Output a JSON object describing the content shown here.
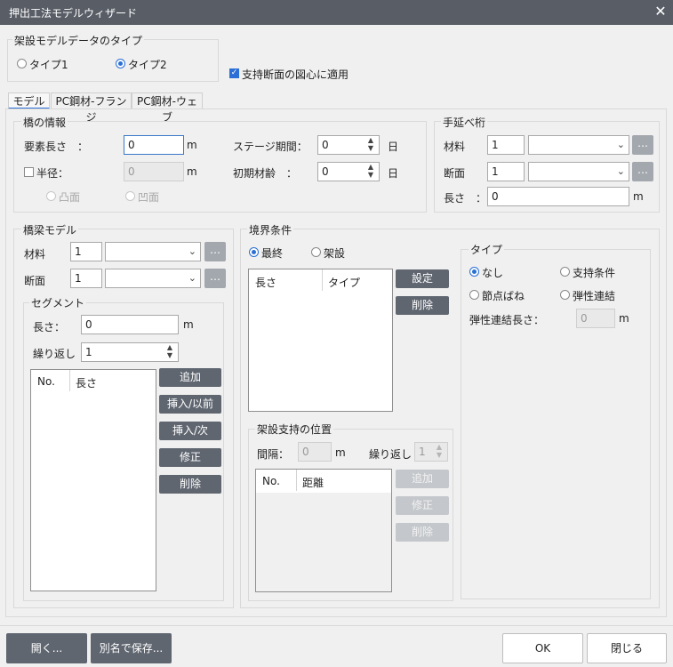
{
  "window": {
    "title": "押出工法モデルウィザード"
  },
  "arch_type": {
    "legend": "架設モデルデータのタイプ",
    "option1": "タイプ1",
    "option2": "タイプ2",
    "selected": "タイプ2"
  },
  "apply_centroid": {
    "label": "支持断面の図心に適用",
    "checked": true
  },
  "tabs": [
    "モデル",
    "PC鋼材-フランジ",
    "PC鋼材-ウェブ"
  ],
  "bridge_info": {
    "legend": "橋の情報",
    "element_length_label": "要素長さ　：",
    "element_length_value": "0",
    "unit_m": "m",
    "radius_label": "半径：",
    "radius_value": "0",
    "convex_label": "凸面",
    "concave_label": "凹面",
    "stage_label": "ステージ期間：",
    "stage_value": "0",
    "initial_age_label": "初期材齢　：",
    "initial_age_value": "0",
    "unit_day": "日"
  },
  "nose": {
    "legend": "手延べ桁",
    "material_label": "材料",
    "material_value": "1",
    "section_label": "断面",
    "section_value": "1",
    "length_label": "長さ　：",
    "length_value": "0",
    "unit_m": "m"
  },
  "girder": {
    "legend": "橋梁モデル",
    "material_label": "材料",
    "material_value": "1",
    "section_label": "断面",
    "section_value": "1"
  },
  "segment": {
    "legend": "セグメント",
    "length_label": "長さ：",
    "length_value": "0",
    "unit_m": "m",
    "repeat_label": "繰り返し",
    "repeat_value": "1",
    "col_no": "No.",
    "col_length": "長さ",
    "add": "追加",
    "insert_before": "挿入/以前",
    "insert_after": "挿入/次",
    "modify": "修正",
    "delete": "削除"
  },
  "boundary": {
    "legend": "境界条件",
    "final": "最終",
    "erection": "架設",
    "col_length": "長さ",
    "col_type": "タイプ",
    "set": "設定",
    "delete": "削除"
  },
  "type_group": {
    "legend": "タイプ",
    "none": "なし",
    "support": "支持条件",
    "node_spring": "節点ばね",
    "elastic_link": "弾性連結",
    "elastic_length_label": "弾性連結長さ：",
    "elastic_length_value": "0",
    "unit_m": "m"
  },
  "support_pos": {
    "legend": "架設支持の位置",
    "interval_label": "間隔：",
    "interval_value": "0",
    "unit_m": "m",
    "repeat_label": "繰り返し",
    "repeat_value": "1",
    "col_no": "No.",
    "col_distance": "距離",
    "add": "追加",
    "modify": "修正",
    "delete": "削除"
  },
  "footer": {
    "open": "開く...",
    "save_as": "別名で保存...",
    "ok": "OK",
    "close": "閉じる"
  }
}
